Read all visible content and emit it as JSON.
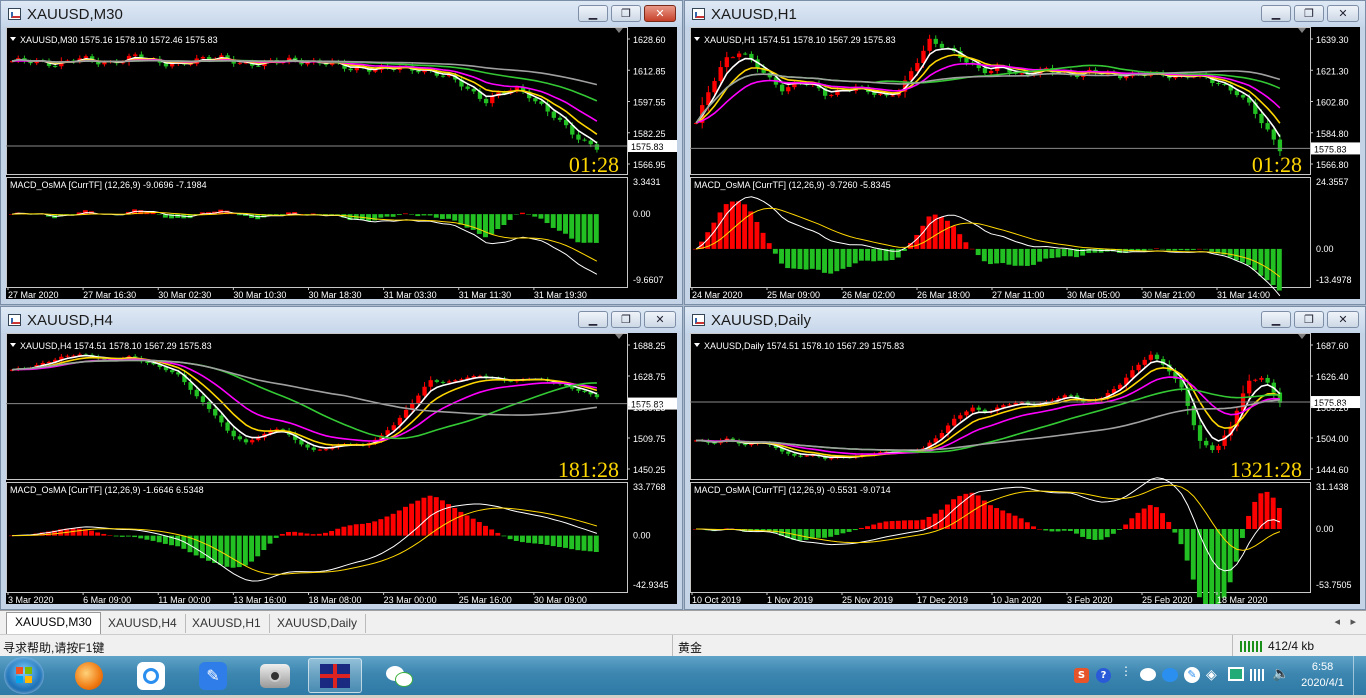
{
  "windows": [
    {
      "title": "XAUUSD,M30",
      "active": true,
      "info": "XAUUSD,M30  1575.16 1578.10 1572.46 1575.83",
      "price_ticks": [
        "1628.60",
        "1612.85",
        "1597.55",
        "1582.25",
        "1566.95"
      ],
      "current_price": "1575.83",
      "timer": "01:28",
      "macd_label": "MACD_OsMA [CurrTF] (12,26,9) -9.0696 -7.1984",
      "macd_ticks": [
        "3.3431",
        "0.00",
        "-9.6607"
      ],
      "time_ticks": [
        "27 Mar 2020",
        "27 Mar 16:30",
        "30 Mar 02:30",
        "30 Mar 10:30",
        "30 Mar 18:30",
        "31 Mar 03:30",
        "31 Mar 11:30",
        "31 Mar 19:30"
      ],
      "price_series": [
        1617,
        1618,
        1618,
        1616,
        1617,
        1619,
        1618,
        1617,
        1618,
        1620,
        1618,
        1617,
        1616,
        1617,
        1619,
        1620,
        1618,
        1615,
        1616,
        1618,
        1619,
        1617,
        1616,
        1617,
        1615,
        1614,
        1613,
        1614,
        1615,
        1614,
        1612,
        1610,
        1608,
        1603,
        1598,
        1601,
        1604,
        1602,
        1596,
        1590,
        1583,
        1578,
        1575.8
      ]
    },
    {
      "title": "XAUUSD,H1",
      "active": false,
      "info": "XAUUSD,H1  1574.51 1578.10 1567.29 1575.83",
      "price_ticks": [
        "1639.30",
        "1621.30",
        "1602.80",
        "1584.80",
        "1566.80"
      ],
      "current_price": "1575.83",
      "timer": "01:28",
      "macd_label": "MACD_OsMA [CurrTF] (12,26,9) -9.7260 -5.8345",
      "macd_ticks": [
        "24.3557",
        "0.00",
        "-13.4978"
      ],
      "time_ticks": [
        "24 Mar 2020",
        "25 Mar 09:00",
        "26 Mar 02:00",
        "26 Mar 18:00",
        "27 Mar 11:00",
        "30 Mar 05:00",
        "30 Mar 21:00",
        "31 Mar 14:00"
      ],
      "price_series": [
        1590,
        1612,
        1628,
        1632,
        1625,
        1616,
        1610,
        1615,
        1612,
        1606,
        1610,
        1612,
        1608,
        1605,
        1610,
        1625,
        1638,
        1634,
        1630,
        1624,
        1620,
        1623,
        1618,
        1620,
        1622,
        1619,
        1618,
        1621,
        1620,
        1617,
        1618,
        1620,
        1619,
        1616,
        1618,
        1617,
        1613,
        1608,
        1600,
        1588,
        1576
      ]
    },
    {
      "title": "XAUUSD,H4",
      "active": false,
      "info": "XAUUSD,H4  1574.51 1578.10 1567.29 1575.83",
      "price_ticks": [
        "1688.25",
        "1628.75",
        "1569.25",
        "1509.75",
        "1450.25"
      ],
      "current_price": "1575.83",
      "timer": "181:28",
      "macd_label": "MACD_OsMA [CurrTF] (12,26,9) -1.6646 6.5348",
      "macd_ticks": [
        "33.7768",
        "0.00",
        "-42.9345"
      ],
      "time_ticks": [
        "3 Mar 2020",
        "6 Mar 09:00",
        "11 Mar 00:00",
        "13 Mar 16:00",
        "18 Mar 08:00",
        "23 Mar 00:00",
        "25 Mar 16:00",
        "30 Mar 09:00"
      ],
      "price_series": [
        1640,
        1645,
        1655,
        1665,
        1670,
        1665,
        1660,
        1665,
        1655,
        1645,
        1630,
        1590,
        1560,
        1520,
        1500,
        1515,
        1530,
        1505,
        1485,
        1490,
        1500,
        1495,
        1510,
        1540,
        1580,
        1620,
        1615,
        1625,
        1630,
        1622,
        1618,
        1625,
        1620,
        1610,
        1600,
        1590
      ]
    },
    {
      "title": "XAUUSD,Daily",
      "active": false,
      "info": "XAUUSD,Daily  1574.51 1578.10 1567.29 1575.83",
      "price_ticks": [
        "1687.60",
        "1626.40",
        "1565.20",
        "1504.00",
        "1444.60"
      ],
      "current_price": "1575.83",
      "timer": "1321:28",
      "macd_label": "MACD_OsMA [CurrTF] (12,26,9) -0.5531 -9.0714",
      "macd_ticks": [
        "31.1438",
        "0.00",
        "-53.7505"
      ],
      "time_ticks": [
        "10 Oct 2019",
        "1 Nov 2019",
        "25 Nov 2019",
        "17 Dec 2019",
        "10 Jan 2020",
        "3 Feb 2020",
        "25 Feb 2020",
        "18 Mar 2020"
      ],
      "price_series": [
        1500,
        1495,
        1505,
        1490,
        1498,
        1485,
        1470,
        1472,
        1465,
        1468,
        1470,
        1475,
        1478,
        1480,
        1485,
        1510,
        1545,
        1565,
        1555,
        1570,
        1575,
        1570,
        1580,
        1590,
        1575,
        1585,
        1605,
        1640,
        1670,
        1645,
        1600,
        1500,
        1480,
        1530,
        1615,
        1625,
        1576
      ]
    }
  ],
  "tabs": [
    "XAUUSD,M30",
    "XAUUSD,H4",
    "XAUUSD,H1",
    "XAUUSD,Daily"
  ],
  "status": {
    "help": "寻求帮助,请按F1键",
    "profile": "黄金",
    "traffic": "412/4 kb"
  },
  "taskbar": {
    "apps": [
      "start-orb-icon",
      "browser-icon",
      "baidu-netdisk-icon",
      "pen-notes-icon",
      "camera-app-icon",
      "mt4-terminal-icon",
      "wechat-icon"
    ],
    "time": "6:58",
    "date": "2020/4/1"
  },
  "colors": {
    "bull": "#ff0000",
    "bear": "#22c022",
    "ma_fast": "#ffffff",
    "ma_yellow": "#ffd700",
    "ma_magenta": "#ff00ff",
    "ma_green": "#34c934",
    "ma_gray": "#a0a0a0",
    "timer": "#ffd700"
  }
}
